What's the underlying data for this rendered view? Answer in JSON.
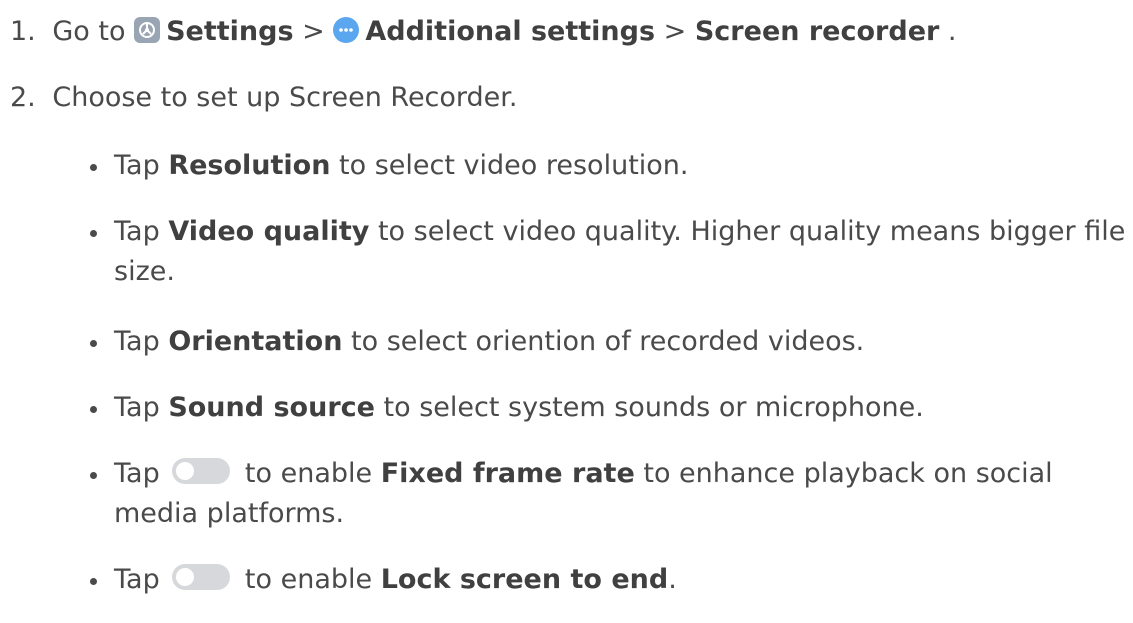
{
  "step1": {
    "number": "1.",
    "prefix": "Go to",
    "settings_label": "Settings",
    "separator1": ">",
    "additional_label": "Additional settings",
    "separator2": ">",
    "recorder_label": "Screen recorder",
    "suffix": "."
  },
  "step2": {
    "number": "2.",
    "text": "Choose to set up Screen Recorder."
  },
  "bullets": {
    "resolution": {
      "pre": "Tap",
      "bold": "Resolution",
      "post": "to select video resolution."
    },
    "video_quality": {
      "pre": "Tap",
      "bold": "Video quality",
      "post": "to select video quality. Higher quality means bigger file size."
    },
    "orientation": {
      "pre": "Tap",
      "bold": "Orientation",
      "post": "to select oriention of recorded videos."
    },
    "sound_source": {
      "pre": "Tap",
      "bold": "Sound source",
      "post": "to select system sounds or microphone."
    },
    "fixed_frame_rate": {
      "pre": "Tap",
      "mid": "to enable",
      "bold": "Fixed frame rate",
      "post": "to enhance playback on social media platforms."
    },
    "lock_screen": {
      "pre": "Tap",
      "mid": "to enable",
      "bold": "Lock screen to end",
      "post": "."
    }
  },
  "icons": {
    "settings": "settings-icon",
    "more": "more-icon",
    "toggle": "toggle-switch-icon"
  },
  "colors": {
    "text": "#4a4a4a",
    "settings_icon": "#9aa5b4",
    "more_icon": "#5aa7f0",
    "toggle": "#d6d8db"
  }
}
